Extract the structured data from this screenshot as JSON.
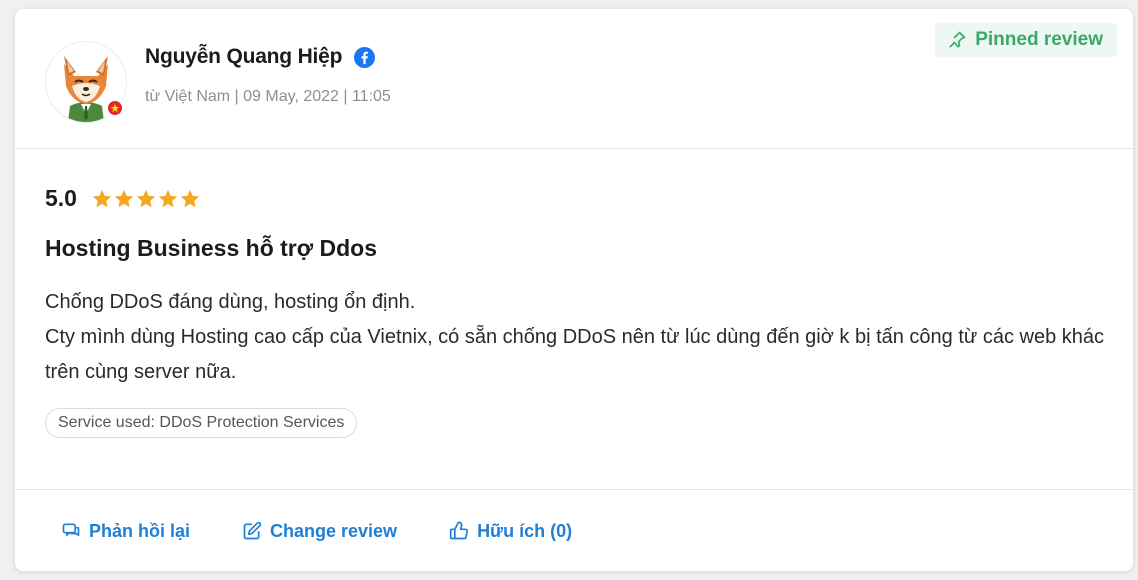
{
  "reviewer": {
    "name": "Nguyễn Quang Hiệp",
    "social_icon": "facebook-icon",
    "meta": "từ Việt Nam | 09 May, 2022 | 11:05",
    "country_flag": "vietnam-flag-icon"
  },
  "pinned": {
    "label": "Pinned review",
    "icon": "pin-icon"
  },
  "review": {
    "score": "5.0",
    "stars": 5,
    "title": "Hosting Business hỗ trợ Ddos",
    "lines": [
      "Chống DDoS đáng dùng, hosting ổn định.",
      "Cty mình dùng Hosting cao cấp của Vietnix, có sẵn chống DDoS nên từ lúc dùng đến giờ k bị tấn công từ các web khác trên cùng server nữa."
    ],
    "service_tag": "Service used: DDoS Protection Services"
  },
  "actions": {
    "reply": "Phản hồi lại",
    "change": "Change review",
    "helpful": "Hữu ích (0)"
  },
  "colors": {
    "accent": "#1f7fd6",
    "pinned_green": "#3aa86a",
    "star": "#f5a623",
    "facebook": "#1877f2"
  }
}
